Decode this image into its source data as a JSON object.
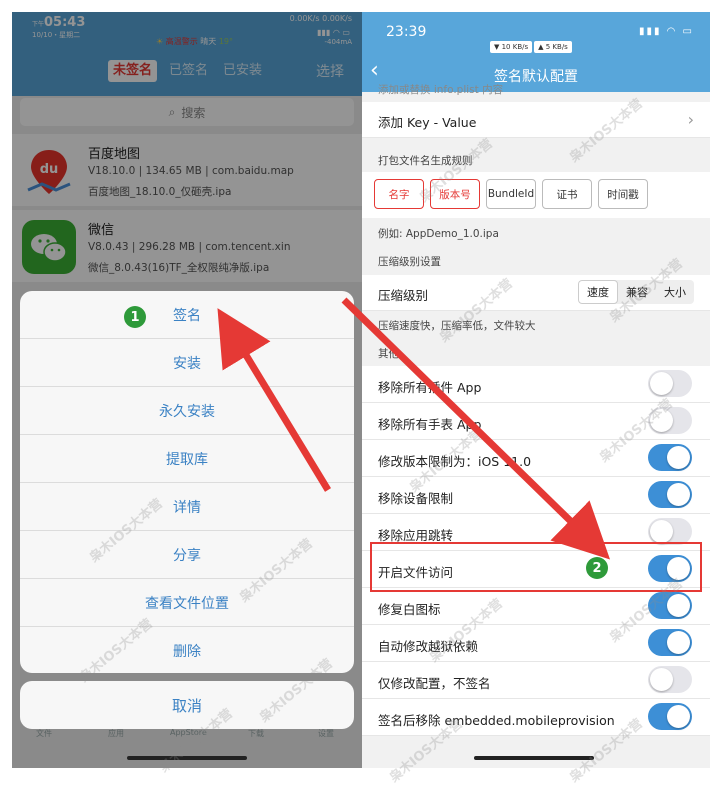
{
  "left": {
    "status": {
      "ampm": "下午",
      "time": "05:43",
      "date": "10/10・星期二",
      "speed": "0.00K/s 0.00K/s",
      "alert": "高温警示",
      "weather": "晴天",
      "temp": "19°",
      "current": "-404mA"
    },
    "tabs": [
      "未签名",
      "已签名",
      "已安装"
    ],
    "active_tab": 0,
    "select_label": "选择",
    "search_placeholder": "搜索",
    "apps": [
      {
        "name": "百度地图",
        "meta": "V18.10.0 | 134.65 MB | com.baidu.map",
        "file": "百度地图_18.10.0_仅砸壳.ipa",
        "icon": "baidu-map-icon"
      },
      {
        "name": "微信",
        "meta": "V8.0.43 | 296.28 MB | com.tencent.xin",
        "file": "微信_8.0.43(16)TF_全权限纯净版.ipa",
        "icon": "wechat-icon"
      }
    ],
    "sheet_items": [
      "签名",
      "安装",
      "永久安装",
      "提取库",
      "详情",
      "分享",
      "查看文件位置",
      "删除"
    ],
    "cancel_label": "取消",
    "tabbar": [
      "文件",
      "应用",
      "AppStore",
      "下载",
      "设置"
    ],
    "badge_label": "1"
  },
  "right": {
    "status": {
      "time": "23:39",
      "down": "▼ 10 KB/s",
      "up": "▲ 5 KB/s"
    },
    "back_label": "‹",
    "title": "签名默认配置",
    "cut_section": "添加或替换 info.plist 内容",
    "add_kv_label": "添加 Key - Value",
    "rule_section": "打包文件名生成规则",
    "chips": [
      {
        "label": "名字",
        "selected": true
      },
      {
        "label": "版本号",
        "selected": true
      },
      {
        "label": "BundleId",
        "selected": false
      },
      {
        "label": "证书",
        "selected": false
      },
      {
        "label": "时间戳",
        "selected": false
      }
    ],
    "example": "例如: AppDemo_1.0.ipa",
    "compress_section": "压缩级别设置",
    "compress_label": "压缩级别",
    "compress_options": [
      "速度",
      "兼容",
      "大小"
    ],
    "compress_selected": 0,
    "compress_note": "压缩速度快，压缩率低，文件较大",
    "other_section": "其他",
    "toggles": [
      {
        "label": "移除所有插件 App",
        "on": false
      },
      {
        "label": "移除所有手表 App",
        "on": false
      },
      {
        "label": "修改版本限制为：iOS 11.0",
        "on": true
      },
      {
        "label": "移除设备限制",
        "on": true
      },
      {
        "label": "移除应用跳转",
        "on": false
      },
      {
        "label": "开启文件访问",
        "on": true
      },
      {
        "label": "修复白图标",
        "on": true
      },
      {
        "label": "自动修改越狱依赖",
        "on": true
      },
      {
        "label": "仅修改配置，不签名",
        "on": false
      },
      {
        "label": "签名后移除 embedded.mobileprovision",
        "on": true
      }
    ],
    "badge_label": "2"
  },
  "watermark": "枭木IOS大本营",
  "colors": {
    "header_blue": "#58a6da",
    "action_blue": "#3b82c4",
    "toggle_on": "#3d8fd6",
    "accent_red": "#e53935",
    "badge_green": "#2e9a3a"
  }
}
